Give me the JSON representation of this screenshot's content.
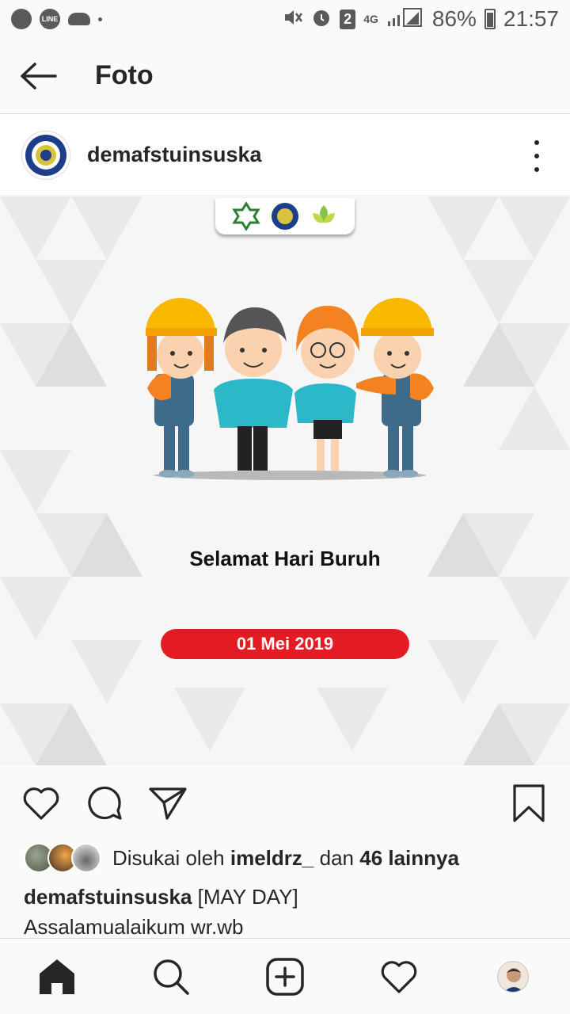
{
  "status_bar": {
    "network": "4G",
    "sim_badge": "2",
    "battery": "86%",
    "time": "21:57",
    "icons": [
      "whatsapp-icon",
      "line-icon",
      "cloud-icon",
      "dot-icon",
      "mute-icon",
      "alarm-icon",
      "signal-icon",
      "battery-icon"
    ]
  },
  "topnav": {
    "title": "Foto",
    "back_icon": "arrow-left-icon"
  },
  "post": {
    "username": "demafstuinsuska",
    "more_icon": "more-vertical-icon",
    "image": {
      "greeting": "Selamat Hari Buruh",
      "date": "01 Mei 2019",
      "colors": {
        "helmet": "#f9b800",
        "shirt_orange": "#f58220",
        "shirt_teal": "#2bb8c8",
        "overalls": "#3f6b8a",
        "pill": "#e31b23"
      }
    }
  },
  "actions": {
    "like_icon": "heart-icon",
    "comment_icon": "comment-icon",
    "share_icon": "send-icon",
    "save_icon": "bookmark-icon"
  },
  "likes": {
    "prefix": "Disukai oleh",
    "user": "imeldrz_",
    "mid": "dan",
    "others": "46 lainnya"
  },
  "caption": {
    "username": "demafstuinsuska",
    "text": "[MAY DAY]",
    "line2": "Assalamualaikum wr.wb"
  },
  "bottom_nav": {
    "items": [
      "home-icon",
      "search-icon",
      "add-post-icon",
      "activity-heart-icon",
      "profile-avatar"
    ]
  }
}
